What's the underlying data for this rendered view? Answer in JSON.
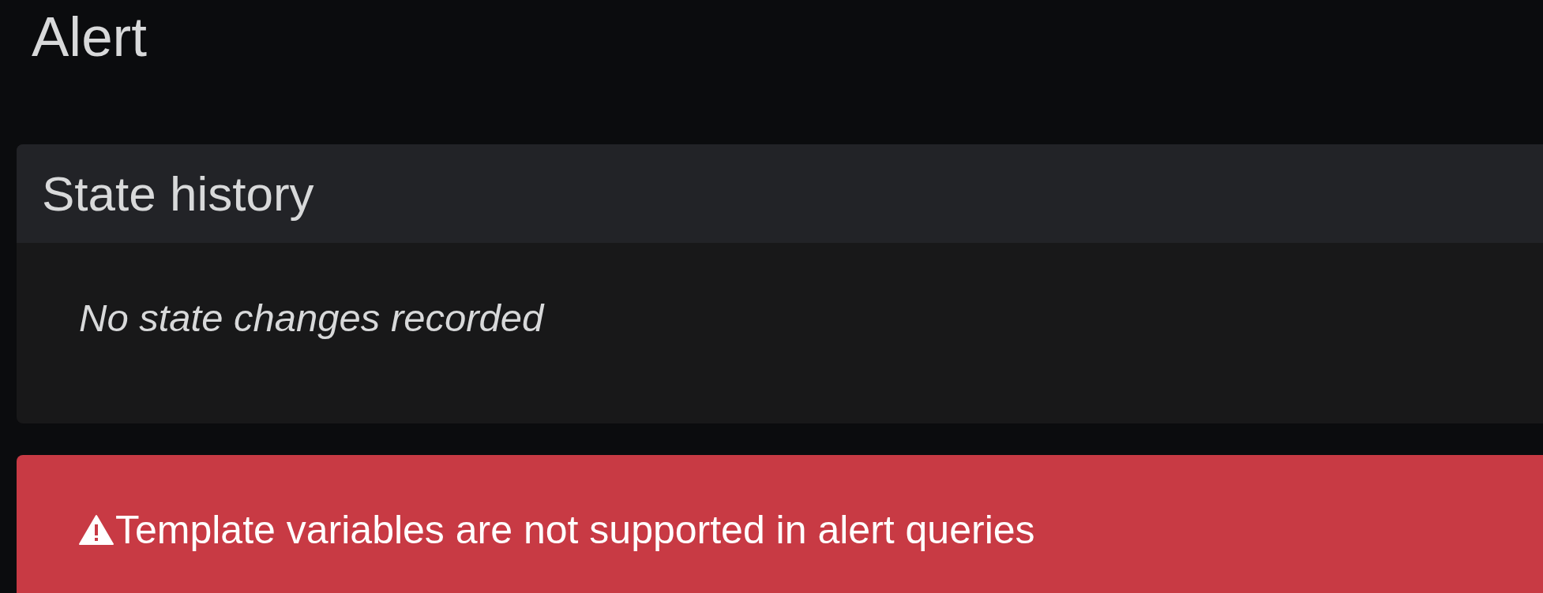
{
  "page": {
    "title": "Alert"
  },
  "state_history": {
    "title": "State history",
    "empty_message": "No state changes recorded"
  },
  "alert_banner": {
    "message": "Template variables are not supported in alert queries"
  }
}
